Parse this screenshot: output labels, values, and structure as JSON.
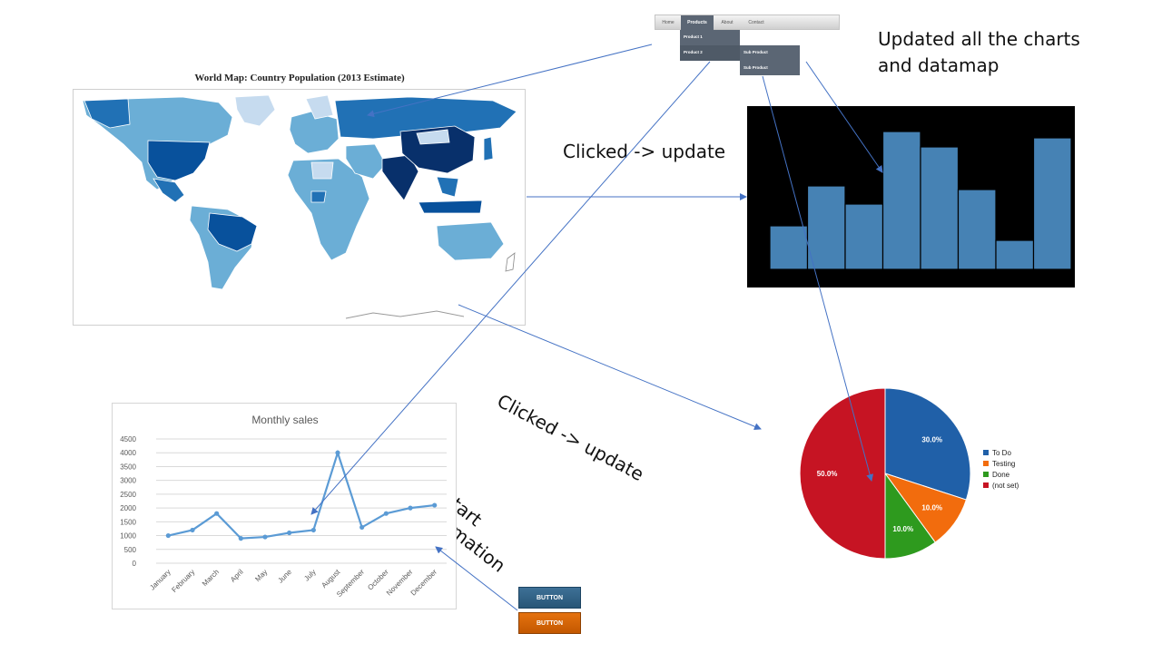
{
  "nav": {
    "items": [
      "Home",
      "Products",
      "About",
      "Contact"
    ],
    "active": "Products",
    "submenu": [
      "Product 1",
      "Product 2"
    ],
    "subsubmenu": [
      "Sub Product",
      "Sub Product"
    ]
  },
  "notes": {
    "updated": "Updated all the charts\nand datamap",
    "clicked_top": "Clicked -> update",
    "clicked_bottom": "Clicked -> update",
    "start": "Start\nanimation"
  },
  "map": {
    "title": "World Map: Country Population (2013 Estimate)"
  },
  "buttons": {
    "blue_label": "BUTTON",
    "orange_label": "BUTTON"
  },
  "colors": {
    "arrow": "#4472c4",
    "bar": "#4682b4",
    "line": "#5b9bd5",
    "map_dark": "#08306b",
    "map_mid": "#2171b5",
    "map_light": "#6baed6",
    "map_pale": "#c6dbef"
  },
  "chart_data": [
    {
      "type": "bar",
      "values": [
        48,
        92,
        72,
        152,
        135,
        88,
        32,
        145
      ],
      "ylim": [
        0,
        160
      ],
      "title": ""
    },
    {
      "type": "line",
      "title": "Monthly sales",
      "categories": [
        "January",
        "February",
        "March",
        "April",
        "May",
        "June",
        "July",
        "August",
        "September",
        "October",
        "November",
        "December"
      ],
      "values": [
        1000,
        1200,
        1800,
        900,
        950,
        1100,
        1200,
        4000,
        1300,
        1800,
        2000,
        2100
      ],
      "ylim": [
        0,
        4500
      ],
      "yticks": [
        0,
        500,
        1000,
        1500,
        2000,
        2500,
        3000,
        3500,
        4000,
        4500
      ],
      "grid": true
    },
    {
      "type": "pie",
      "labels": [
        "To Do",
        "Testing",
        "Done",
        "(not set)"
      ],
      "values": [
        30.0,
        10.0,
        10.0,
        50.0
      ],
      "value_labels": [
        "30.0%",
        "10.0%",
        "10.0%",
        "50.0%"
      ],
      "colors": [
        "#2060a8",
        "#f26c0d",
        "#2e9a1e",
        "#c61423"
      ],
      "legend": "right"
    }
  ]
}
